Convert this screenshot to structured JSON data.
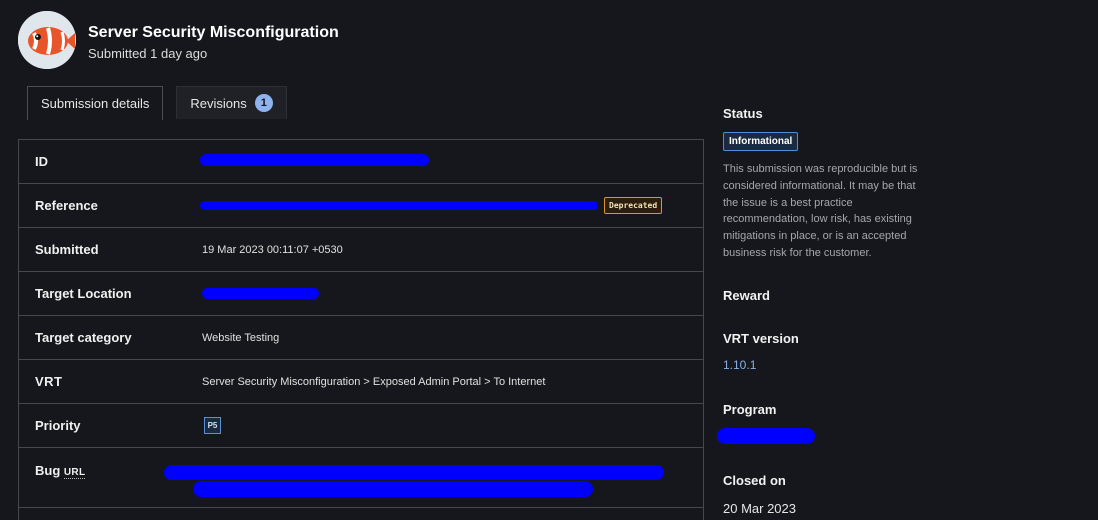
{
  "header": {
    "title": "Server Security Misconfiguration",
    "subtitle": "Submitted 1 day ago",
    "avatar_icon": "clownfish-avatar"
  },
  "tabs": [
    {
      "label": "Submission details",
      "active": true
    },
    {
      "label": "Revisions",
      "count": "1",
      "active": false
    }
  ],
  "details": {
    "id_label": "ID",
    "reference_label": "Reference",
    "reference_badge": "Deprecated",
    "submitted_label": "Submitted",
    "submitted_value": "19 Mar 2023 00:11:07 +0530",
    "target_location_label": "Target Location",
    "target_category_label": "Target category",
    "target_category_value": "Website Testing",
    "vrt_label": "VRT",
    "vrt_value": "Server Security Misconfiguration > Exposed Admin Portal > To Internet",
    "priority_label": "Priority",
    "priority_value": "P5",
    "bug_url_label": "Bug",
    "bug_url_abbr": "URL"
  },
  "sidebar": {
    "status_heading": "Status",
    "status_badge": "Informational",
    "status_description": "This submission was reproducible but is considered informational. It may be that the issue is a best practice recommendation, low risk, has existing mitigations in place, or is an accepted business risk for the customer.",
    "reward_heading": "Reward",
    "vrt_logo": "VRT",
    "vrt_version_heading": "version",
    "vrt_version_value": "1.10.1",
    "program_heading": "Program",
    "closed_heading": "Closed on",
    "closed_value": "20 Mar 2023"
  },
  "colors": {
    "background": "#16171c",
    "border": "#45484f",
    "status_blue": "#4f8edc",
    "deprecated_orange": "#d9962a",
    "link": "#86aee8",
    "redaction": "#0000ff"
  }
}
